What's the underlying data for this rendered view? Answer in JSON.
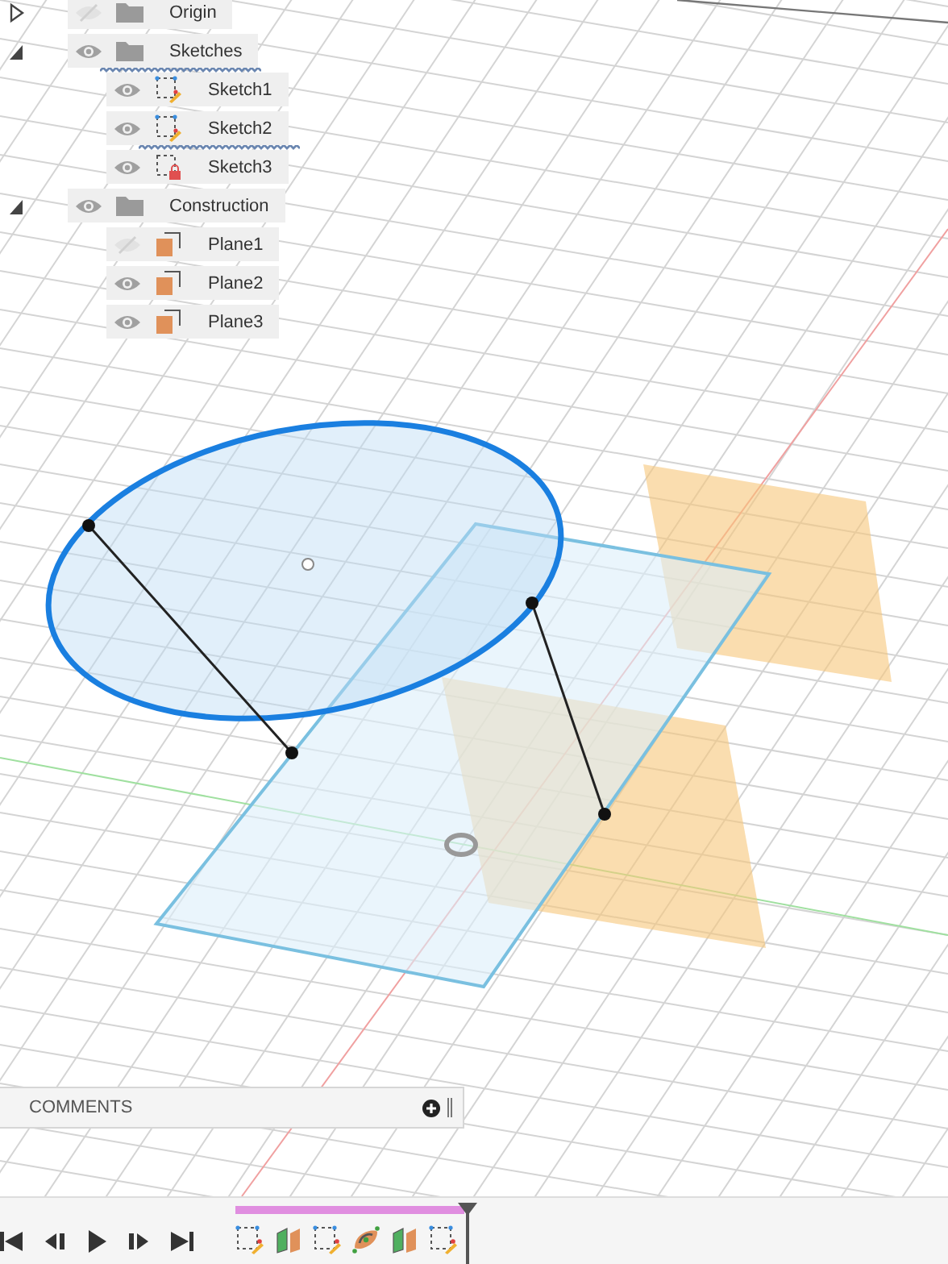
{
  "browser": {
    "items": [
      {
        "label": "Origin",
        "kind": "folder",
        "expanded": false,
        "visible": false,
        "flagged": false
      },
      {
        "label": "Sketches",
        "kind": "folder",
        "expanded": true,
        "visible": true,
        "flagged": true,
        "children": [
          {
            "label": "Sketch1",
            "kind": "sketch",
            "visible": true,
            "locked": false,
            "flagged": false
          },
          {
            "label": "Sketch2",
            "kind": "sketch",
            "visible": true,
            "locked": false,
            "flagged": true
          },
          {
            "label": "Sketch3",
            "kind": "sketch",
            "visible": true,
            "locked": true,
            "flagged": false
          }
        ]
      },
      {
        "label": "Construction",
        "kind": "folder",
        "expanded": true,
        "visible": true,
        "flagged": false,
        "children": [
          {
            "label": "Plane1",
            "kind": "plane",
            "visible": false,
            "flagged": false
          },
          {
            "label": "Plane2",
            "kind": "plane",
            "visible": true,
            "flagged": false
          },
          {
            "label": "Plane3",
            "kind": "plane",
            "visible": true,
            "flagged": false
          }
        ]
      }
    ]
  },
  "comments": {
    "title": "COMMENTS"
  },
  "timeline": {
    "features": [
      {
        "kind": "sketch"
      },
      {
        "kind": "plane"
      },
      {
        "kind": "sketch"
      },
      {
        "kind": "axis"
      },
      {
        "kind": "plane"
      },
      {
        "kind": "sketch"
      }
    ]
  }
}
